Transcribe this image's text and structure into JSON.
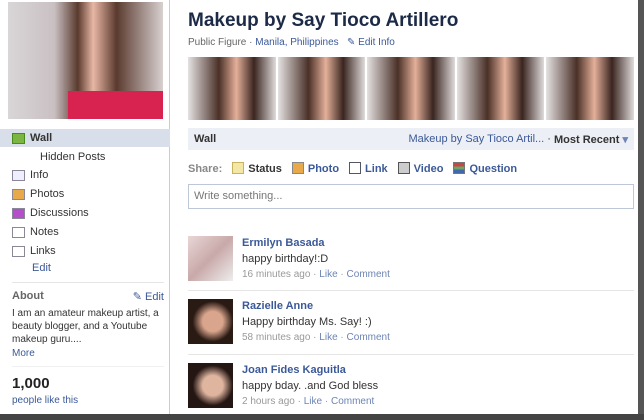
{
  "page": {
    "title": "Makeup by Say Tioco Artillero",
    "category": "Public Figure",
    "location": "Manila, Philippines",
    "edit_info": "Edit Info"
  },
  "sidebar": {
    "items": [
      {
        "label": "Wall"
      },
      {
        "label": "Hidden Posts"
      },
      {
        "label": "Info"
      },
      {
        "label": "Photos"
      },
      {
        "label": "Discussions"
      },
      {
        "label": "Notes"
      },
      {
        "label": "Links"
      }
    ],
    "edit": "Edit",
    "about": {
      "heading": "About",
      "edit": "Edit",
      "text": "I am an amateur makeup artist, a beauty blogger, and a Youtube makeup guru....",
      "more": "More"
    },
    "likes": {
      "count": "1,000",
      "label": "people like this"
    }
  },
  "wall": {
    "label": "Wall",
    "filter_page": "Makeup by Say Tioco Artil...",
    "sep": "·",
    "filter": "Most Recent"
  },
  "share": {
    "label": "Share:",
    "options": [
      "Status",
      "Photo",
      "Link",
      "Video",
      "Question"
    ],
    "placeholder": "Write something..."
  },
  "posts": [
    {
      "name": "Ermilyn Basada",
      "text": "happy birthday!:D",
      "time": "16 minutes ago",
      "like": "Like",
      "comment": "Comment"
    },
    {
      "name": "Razielle Anne",
      "text": "Happy birthday Ms. Say! :)",
      "time": "58 minutes ago",
      "like": "Like",
      "comment": "Comment"
    },
    {
      "name": "Joan Fides Kaguitla",
      "text": "happy bday. .and God bless",
      "time": "2 hours ago",
      "like": "Like",
      "comment": "Comment"
    }
  ]
}
